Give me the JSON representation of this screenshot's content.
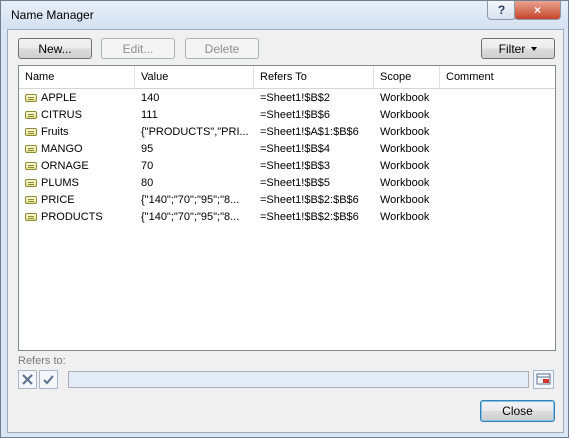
{
  "window": {
    "title": "Name Manager"
  },
  "titlebar": {
    "help_label": "?",
    "close_label": "×"
  },
  "toolbar": {
    "new_label": "New...",
    "edit_label": "Edit...",
    "delete_label": "Delete",
    "filter_label": "Filter"
  },
  "columns": [
    "Name",
    "Value",
    "Refers To",
    "Scope",
    "Comment"
  ],
  "rows": [
    {
      "name": "APPLE",
      "value": "140",
      "refers_to": "=Sheet1!$B$2",
      "scope": "Workbook",
      "comment": ""
    },
    {
      "name": "CITRUS",
      "value": "111",
      "refers_to": "=Sheet1!$B$6",
      "scope": "Workbook",
      "comment": ""
    },
    {
      "name": "Fruits",
      "value": "{\"PRODUCTS\",\"PRI...",
      "refers_to": "=Sheet1!$A$1:$B$6",
      "scope": "Workbook",
      "comment": ""
    },
    {
      "name": "MANGO",
      "value": "95",
      "refers_to": "=Sheet1!$B$4",
      "scope": "Workbook",
      "comment": ""
    },
    {
      "name": "ORNAGE",
      "value": "70",
      "refers_to": "=Sheet1!$B$3",
      "scope": "Workbook",
      "comment": ""
    },
    {
      "name": "PLUMS",
      "value": "80",
      "refers_to": "=Sheet1!$B$5",
      "scope": "Workbook",
      "comment": ""
    },
    {
      "name": "PRICE",
      "value": "{\"140\";\"70\";\"95\";\"8...",
      "refers_to": "=Sheet1!$B$2:$B$6",
      "scope": "Workbook",
      "comment": ""
    },
    {
      "name": "PRODUCTS",
      "value": "{\"140\";\"70\";\"95\";\"8...",
      "refers_to": "=Sheet1!$B$2:$B$6",
      "scope": "Workbook",
      "comment": ""
    }
  ],
  "refers": {
    "label": "Refers to:",
    "value": ""
  },
  "footer": {
    "close_label": "Close"
  }
}
